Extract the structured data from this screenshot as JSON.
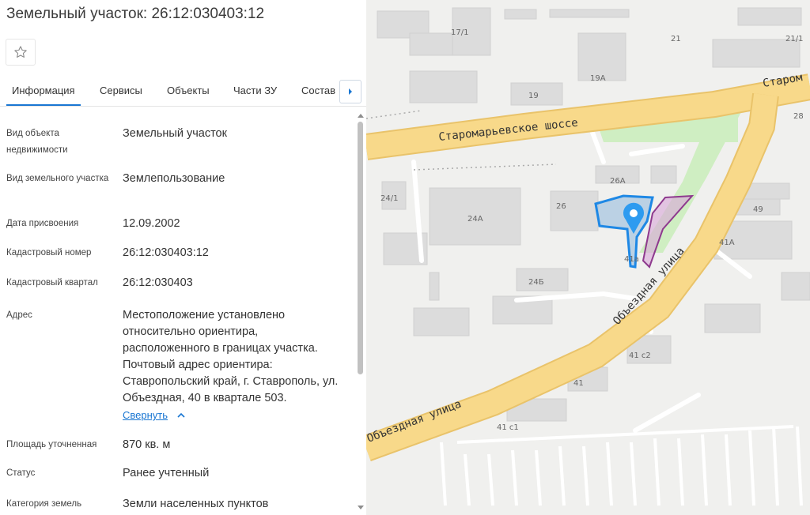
{
  "panel": {
    "title": "Земельный участок: 26:12:030403:12",
    "favorite_icon": "star-outline-icon",
    "tabs": [
      {
        "label": "Информация",
        "active": true
      },
      {
        "label": "Сервисы",
        "active": false
      },
      {
        "label": "Объекты",
        "active": false
      },
      {
        "label": "Части ЗУ",
        "active": false
      },
      {
        "label": "Состав",
        "active": false
      }
    ],
    "tabs_next_icon": "caret-right-icon",
    "fields": [
      {
        "label": "Вид объекта недвижимости",
        "value": "Земельный участок"
      },
      {
        "label": "Вид земельного участка",
        "value": "Землепользование"
      },
      {
        "label": "Дата присвоения",
        "value": "12.09.2002"
      },
      {
        "label": "Кадастровый номер",
        "value": "26:12:030403:12"
      },
      {
        "label": "Кадастровый квартал",
        "value": "26:12:030403"
      },
      {
        "label": "Адрес",
        "value": "Местоположение установлено относительно ориентира, расположенного в границах участка. Почтовый адрес ориентира: Ставропольский край, г. Ставрополь, ул. Объездная, 40 в квартале 503."
      },
      {
        "label": "Площадь уточненная",
        "value": "870 кв. м"
      },
      {
        "label": "Статус",
        "value": "Ранее учтенный"
      },
      {
        "label": "Категория земель",
        "value": "Земли населенных пунктов"
      }
    ],
    "collapse_label": "Свернуть",
    "collapse_icon": "chevron-up-icon",
    "accent_color": "#1976d2"
  },
  "map": {
    "streets": {
      "staromarevskoe": "Старомарьевское шоссе",
      "staromarevskoe_short": "Старом",
      "obezdnaya_diag": "Объездная улица",
      "obezdnaya_bottom": "Объездная улица"
    },
    "buildings": [
      "17/1",
      "21",
      "21/1",
      "19",
      "19А",
      "28",
      "24/1",
      "26А",
      "26",
      "24А",
      "49",
      "41А",
      "24Б",
      "41 с2",
      "41",
      "41 с1",
      "41а"
    ],
    "marker_icon": "map-pin-icon",
    "parcel_color": "#1e88e5",
    "neighbor_parcel_color": "#8e3a8e",
    "road_color": "#f8d98a"
  }
}
